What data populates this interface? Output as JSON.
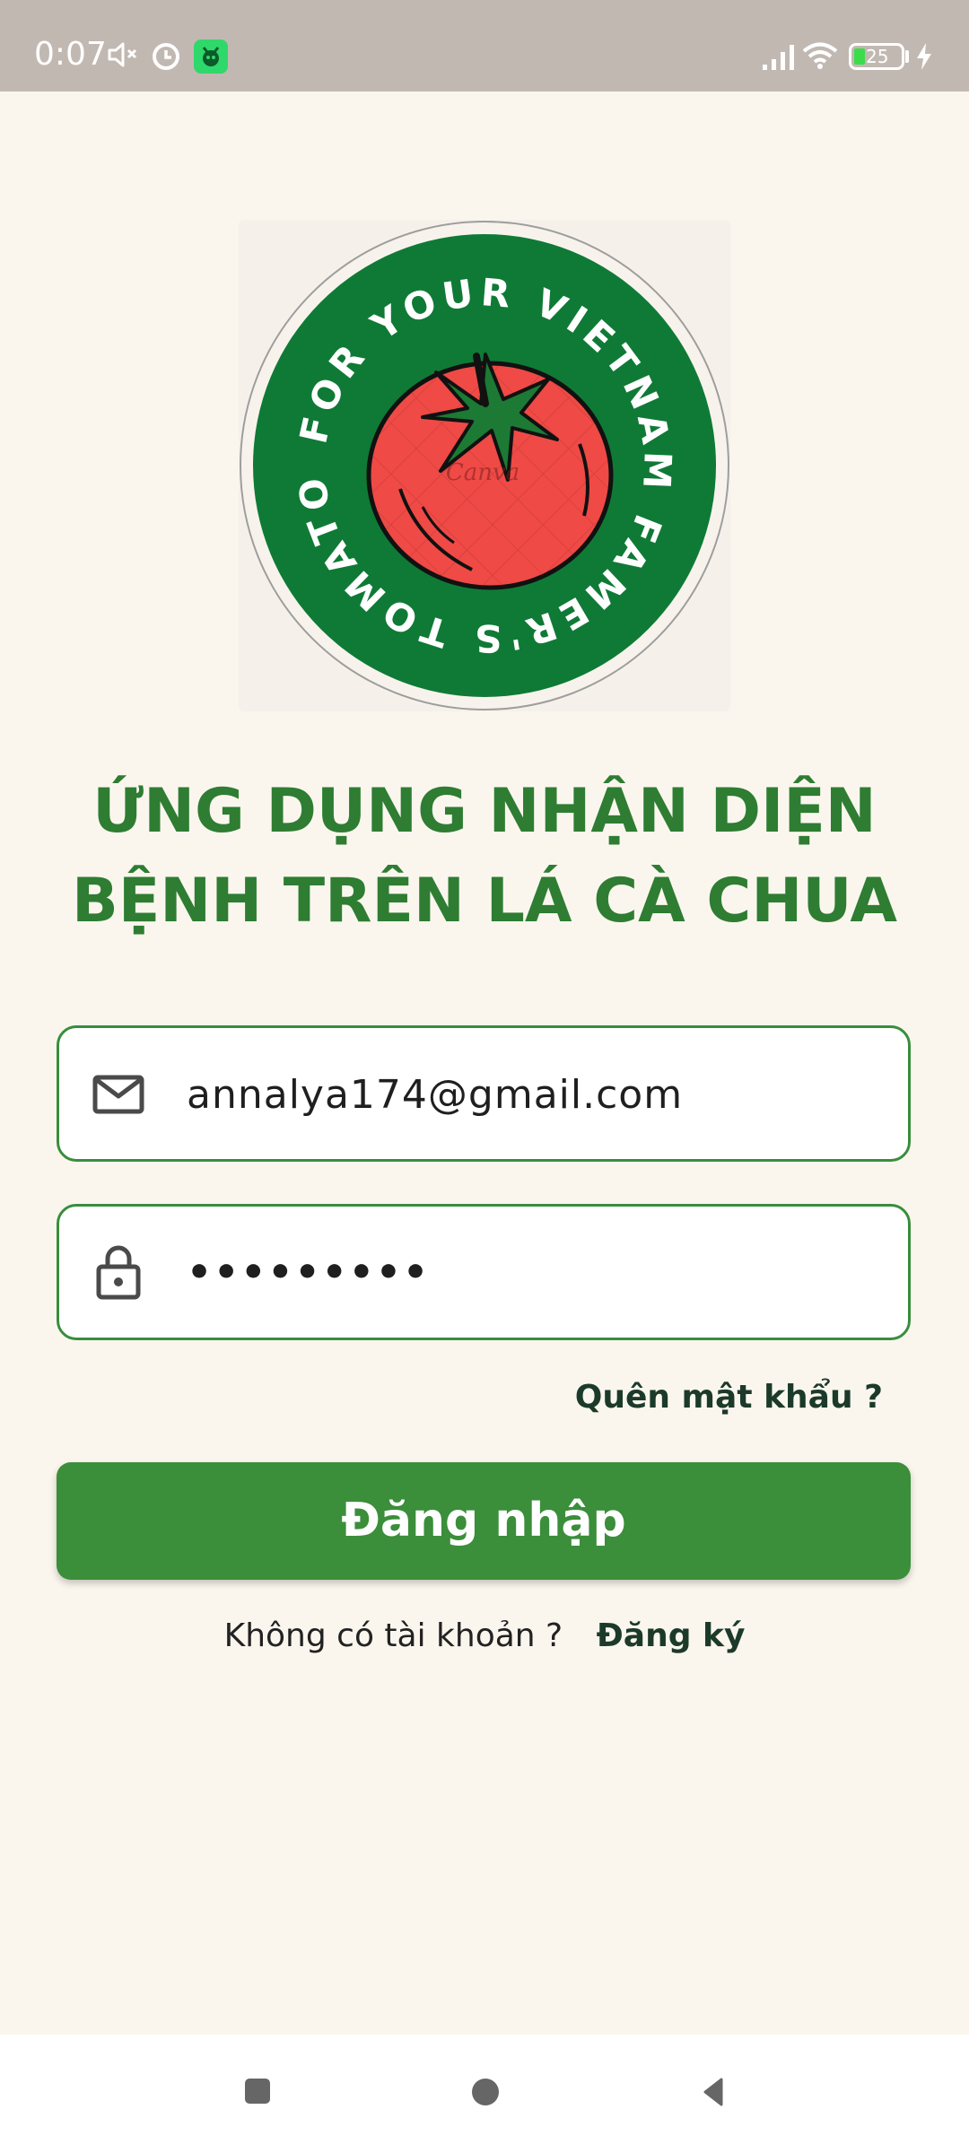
{
  "status_bar": {
    "time": "0:07",
    "battery_level": "25",
    "icons": [
      "mute-icon",
      "alarm-icon",
      "app-notification-icon",
      "signal-icon",
      "wifi-icon",
      "battery-icon",
      "charging-icon"
    ]
  },
  "logo": {
    "ring_text": "FOR YOUR VIETNAM FAMER'S TOMATO",
    "watermark": "Canva",
    "colors": {
      "ring": "#0f7a36",
      "tomato": "#ef4a45",
      "leaf": "#1c7a34"
    }
  },
  "title": {
    "line1": "ỨNG DỤNG NHẬN DIỆN",
    "line2": "BỆNH TRÊN LÁ CÀ CHUA"
  },
  "form": {
    "email_value": "annalya174@gmail.com",
    "password_value": "•••••••••",
    "forgot_label": "Quên mật khẩu ?",
    "login_label": "Đăng nhập",
    "no_account_label": "Không có tài khoản ?",
    "register_label": "Đăng ký"
  },
  "colors": {
    "accent": "#2e7d32",
    "button": "#3b8e3a",
    "background": "#faf6ee"
  },
  "nav_bar": {
    "buttons": [
      "recents-button",
      "home-button",
      "back-button"
    ]
  }
}
